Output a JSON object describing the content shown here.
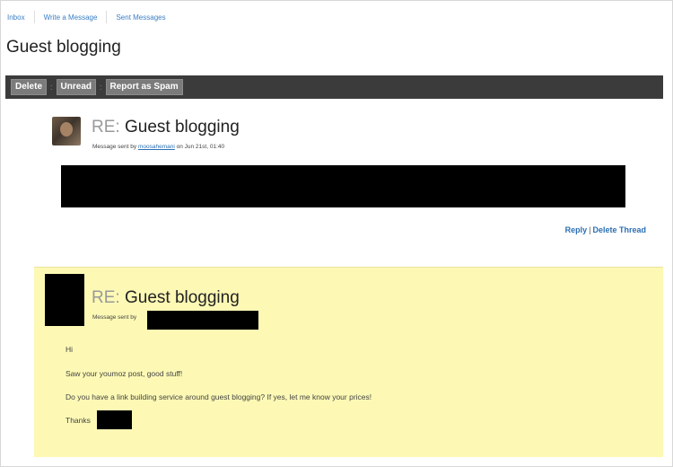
{
  "nav": {
    "inbox": "Inbox",
    "write": "Write a Message",
    "sent": "Sent Messages"
  },
  "page_title": "Guest blogging",
  "toolbar": {
    "delete": "Delete",
    "unread": "Unread",
    "spam": "Report as Spam",
    "separator": ":"
  },
  "message1": {
    "re_prefix": "RE:",
    "subject": "Guest blogging",
    "meta_prefix": "Message sent by",
    "sender": "moosahemani",
    "meta_suffix": "on Jun 21st, 01:40"
  },
  "actions": {
    "reply": "Reply",
    "pipe": "|",
    "delete_thread": "Delete Thread"
  },
  "message2": {
    "re_prefix": "RE:",
    "subject": "Guest blogging",
    "meta_prefix": "Message sent by",
    "lines": [
      "Hi",
      "Saw your youmoz post, good stuff!",
      "Do you have a link building service around guest blogging? If yes, let me know your prices!",
      "Thanks"
    ]
  },
  "colors": {
    "link": "#3a7fc4",
    "toolbar_bg": "#3b3b3b",
    "highlight_bg": "#fdf9b5"
  }
}
